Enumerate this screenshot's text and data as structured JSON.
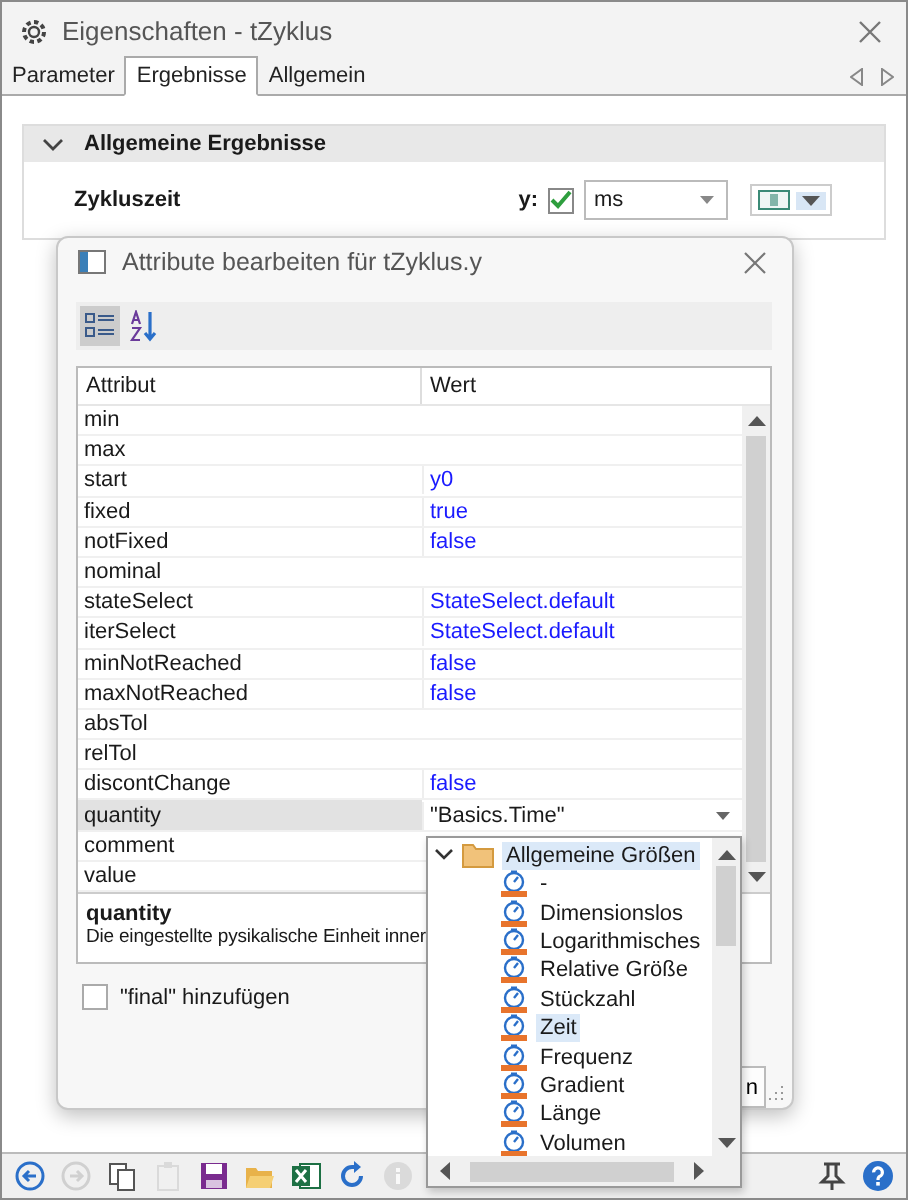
{
  "window": {
    "title": "Eigenschaften - tZyklus"
  },
  "tabs": [
    {
      "label": "Parameter",
      "selected": false
    },
    {
      "label": "Ergebnisse",
      "selected": true
    },
    {
      "label": "Allgemein",
      "selected": false
    }
  ],
  "section": {
    "title": "Allgemeine Ergebnisse",
    "expanded": true,
    "row": {
      "label": "Zykluszeit",
      "var_label": "y:",
      "checked": true,
      "unit": "ms"
    }
  },
  "dialog": {
    "title": "Attribute bearbeiten für tZyklus.y",
    "columns": [
      "Attribut",
      "Wert"
    ],
    "rows": [
      {
        "name": "min",
        "value": "",
        "selected": false
      },
      {
        "name": "max",
        "value": "",
        "selected": false
      },
      {
        "name": "start",
        "value": "y0",
        "selected": false
      },
      {
        "name": "fixed",
        "value": "true",
        "selected": false
      },
      {
        "name": "notFixed",
        "value": "false",
        "selected": false
      },
      {
        "name": "nominal",
        "value": "",
        "selected": false
      },
      {
        "name": "stateSelect",
        "value": "StateSelect.default",
        "selected": false
      },
      {
        "name": "iterSelect",
        "value": "StateSelect.default",
        "selected": false
      },
      {
        "name": "minNotReached",
        "value": "false",
        "selected": false
      },
      {
        "name": "maxNotReached",
        "value": "false",
        "selected": false
      },
      {
        "name": "absTol",
        "value": "",
        "selected": false
      },
      {
        "name": "relTol",
        "value": "",
        "selected": false
      },
      {
        "name": "discontChange",
        "value": "false",
        "selected": false
      },
      {
        "name": "quantity",
        "value": "\"Basics.Time\"",
        "selected": true
      },
      {
        "name": "comment",
        "value": "",
        "selected": false
      },
      {
        "name": "value",
        "value": "",
        "selected": false
      }
    ],
    "description": {
      "title": "quantity",
      "text": "Die eingestellte pysikalische Einheit inner"
    },
    "final_option": {
      "label": "\"final\" hinzufügen",
      "checked": false
    },
    "button_label": "n"
  },
  "dropdown": {
    "label": "Allgemeine Größen",
    "expanded": true,
    "selected": true,
    "children": [
      {
        "label": "-",
        "selected": false
      },
      {
        "label": "Dimensionslos",
        "selected": false
      },
      {
        "label": "Logarithmisches",
        "selected": false
      },
      {
        "label": "Relative Größe",
        "selected": false
      },
      {
        "label": "Stückzahl",
        "selected": false
      },
      {
        "label": "Zeit",
        "selected": true
      },
      {
        "label": "Frequenz",
        "selected": false
      },
      {
        "label": "Gradient",
        "selected": false
      },
      {
        "label": "Länge",
        "selected": false
      },
      {
        "label": "Volumen",
        "selected": false
      }
    ]
  },
  "toolbar": [
    {
      "kind": "back",
      "disabled": false
    },
    {
      "kind": "forward",
      "disabled": true
    },
    {
      "kind": "copy",
      "disabled": false
    },
    {
      "kind": "paste",
      "disabled": true
    },
    {
      "kind": "save",
      "disabled": false
    },
    {
      "kind": "open",
      "disabled": false
    },
    {
      "kind": "excel",
      "disabled": false
    },
    {
      "kind": "refresh",
      "disabled": false
    },
    {
      "kind": "info",
      "disabled": true
    }
  ],
  "toolbar_right": [
    {
      "kind": "pin",
      "disabled": false
    },
    {
      "kind": "help",
      "disabled": false
    }
  ]
}
